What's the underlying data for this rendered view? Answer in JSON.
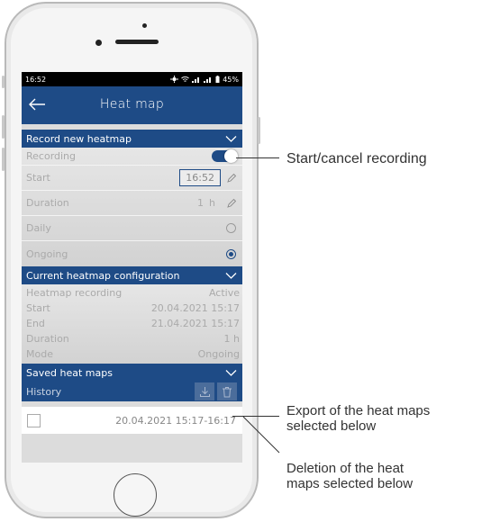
{
  "status_bar": {
    "time": "16:52",
    "battery": "45%"
  },
  "app_bar": {
    "title": "Heat map",
    "back_icon": "arrow-left-icon"
  },
  "record_section": {
    "title": "Record new heatmap",
    "recording_label": "Recording",
    "recording_on": true,
    "start_label": "Start",
    "start_time": "16:52",
    "duration_label": "Duration",
    "duration_value": "1",
    "duration_unit": "h",
    "daily_label": "Daily",
    "ongoing_label": "Ongoing",
    "selected_mode": "Ongoing"
  },
  "config_section": {
    "title": "Current heatmap configuration",
    "rows": [
      {
        "label": "Heatmap recording",
        "value": "Active"
      },
      {
        "label": "Start",
        "value": "20.04.2021 15:17"
      },
      {
        "label": "End",
        "value": "21.04.2021 15:17"
      },
      {
        "label": "Duration",
        "value": "1 h"
      },
      {
        "label": "Mode",
        "value": "Ongoing"
      }
    ]
  },
  "saved_section": {
    "title": "Saved heat maps",
    "history_label": "History",
    "items": [
      {
        "range": "20.04.2021 15:17-16:17",
        "checked": false
      }
    ]
  },
  "annotations": {
    "recording": "Start/cancel recording",
    "export": [
      "Export of the heat maps",
      "selected below"
    ],
    "delete": [
      "Deletion of the heat",
      "maps selected below"
    ]
  },
  "colors": {
    "primary": "#1e4b86",
    "screen_bg": "#dcdcdc",
    "text_muted": "#aaaaaa"
  }
}
